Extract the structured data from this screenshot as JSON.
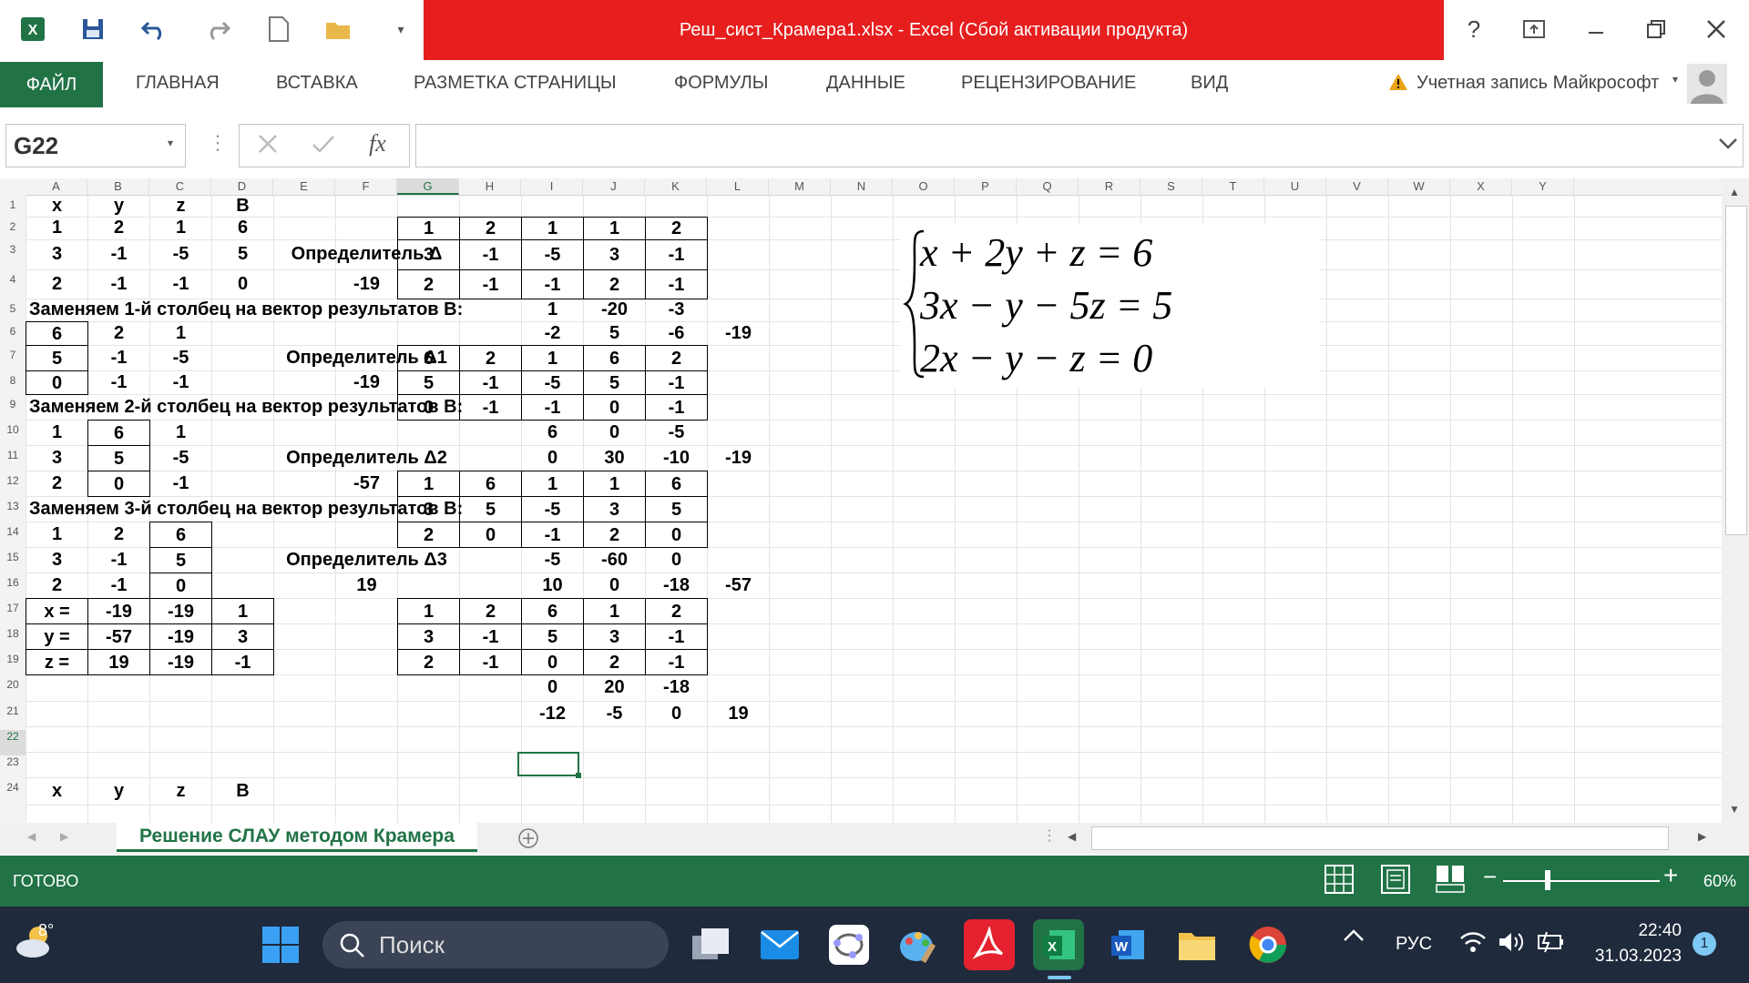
{
  "window": {
    "title": "Реш_сист_Крамера1.xlsx -  Excel (Сбой активации продукта)",
    "help": "?"
  },
  "ribbon": {
    "tabs": [
      "ФАЙЛ",
      "ГЛАВНАЯ",
      "ВСТАВКА",
      "РАЗМЕТКА СТРАНИЦЫ",
      "ФОРМУЛЫ",
      "ДАННЫЕ",
      "РЕЦЕНЗИРОВАНИЕ",
      "ВИД"
    ],
    "account": "Учетная запись Майкрософт"
  },
  "formula_bar": {
    "name_box": "G22",
    "fx": "fx",
    "value": ""
  },
  "columns": [
    "A",
    "B",
    "C",
    "D",
    "E",
    "F",
    "G",
    "H",
    "I",
    "J",
    "K",
    "L",
    "M",
    "N",
    "O",
    "P",
    "Q",
    "R",
    "S",
    "T",
    "U",
    "V",
    "W",
    "X",
    "Y"
  ],
  "rows": [
    "1",
    "2",
    "3",
    "4",
    "5",
    "6",
    "7",
    "8",
    "9",
    "10",
    "11",
    "12",
    "13",
    "14",
    "15",
    "16",
    "17",
    "18",
    "19",
    "20",
    "21",
    "22",
    "23",
    "24"
  ],
  "cells": {
    "r1": [
      "x",
      "y",
      "z",
      "B"
    ],
    "r2": [
      "1",
      "2",
      "1",
      "6"
    ],
    "r3": [
      "3",
      "-1",
      "-5",
      "5"
    ],
    "r4": [
      "2",
      "-1",
      "-1",
      "0"
    ],
    "r6": [
      "6",
      "2",
      "1"
    ],
    "r7": [
      "5",
      "-1",
      "-5"
    ],
    "r8": [
      "0",
      "-1",
      "-1"
    ],
    "r10": [
      "1",
      "6",
      "1"
    ],
    "r11": [
      "3",
      "5",
      "-5"
    ],
    "r12": [
      "2",
      "0",
      "-1"
    ],
    "r14": [
      "1",
      "2",
      "6"
    ],
    "r15": [
      "3",
      "-1",
      "5"
    ],
    "r16": [
      "2",
      "-1",
      "0"
    ],
    "r17": [
      "x =",
      "-19",
      "-19",
      "1"
    ],
    "r18": [
      "y =",
      "-57",
      "-19",
      "3"
    ],
    "r19": [
      "z =",
      "19",
      "-19",
      "-1"
    ],
    "r24": [
      "x",
      "y",
      "z",
      "B"
    ],
    "F3": "Определитель Δ",
    "F4": "-19",
    "F7": "Определитель Δ1",
    "F8": "-19",
    "F11": "Определитель Δ2",
    "F12": "-57",
    "F15": "Определитель Δ3",
    "F16": "19",
    "A5": "Заменяем 1-й столбец на вектор результатов В:",
    "A9": "Заменяем 2-й столбец на вектор результатов В:",
    "A13": "Заменяем 3-й столбец на вектор результатов В:",
    "g2": [
      "1",
      "2",
      "1",
      "1",
      "2"
    ],
    "g3": [
      "3",
      "-1",
      "-5",
      "3",
      "-1"
    ],
    "g4": [
      "2",
      "-1",
      "-1",
      "2",
      "-1"
    ],
    "i5": [
      "1",
      "-20",
      "-3"
    ],
    "i6": [
      "-2",
      "5",
      "-6",
      "-19"
    ],
    "g7": [
      "6",
      "2",
      "1",
      "6",
      "2"
    ],
    "g8": [
      "5",
      "-1",
      "-5",
      "5",
      "-1"
    ],
    "g9": [
      "0",
      "-1",
      "-1",
      "0",
      "-1"
    ],
    "i10": [
      "6",
      "0",
      "-5"
    ],
    "i11": [
      "0",
      "30",
      "-10",
      "-19"
    ],
    "g12": [
      "1",
      "6",
      "1",
      "1",
      "6"
    ],
    "g13": [
      "3",
      "5",
      "-5",
      "3",
      "5"
    ],
    "g14": [
      "2",
      "0",
      "-1",
      "2",
      "0"
    ],
    "i15": [
      "-5",
      "-60",
      "0"
    ],
    "i16": [
      "10",
      "0",
      "-18",
      "-57"
    ],
    "g17": [
      "1",
      "2",
      "6",
      "1",
      "2"
    ],
    "g18": [
      "3",
      "-1",
      "5",
      "3",
      "-1"
    ],
    "g19": [
      "2",
      "-1",
      "0",
      "2",
      "-1"
    ],
    "i20": [
      "0",
      "20",
      "-18"
    ],
    "i21": [
      "-12",
      "-5",
      "0",
      "19"
    ]
  },
  "equations": [
    "x + 2y + z = 6",
    "3x − y − 5z = 5",
    "2x − y − z = 0"
  ],
  "sheet_tab": "Решение СЛАУ методом Крамера",
  "status": {
    "ready": "ГОТОВО",
    "zoom": "60%"
  },
  "taskbar": {
    "weather": "8°",
    "search": "Поиск",
    "lang": "РУС",
    "time": "22:40",
    "date": "31.03.2023",
    "notif": "1"
  },
  "colors": {
    "accent": "#217346",
    "title_red": "#e61e1e"
  }
}
